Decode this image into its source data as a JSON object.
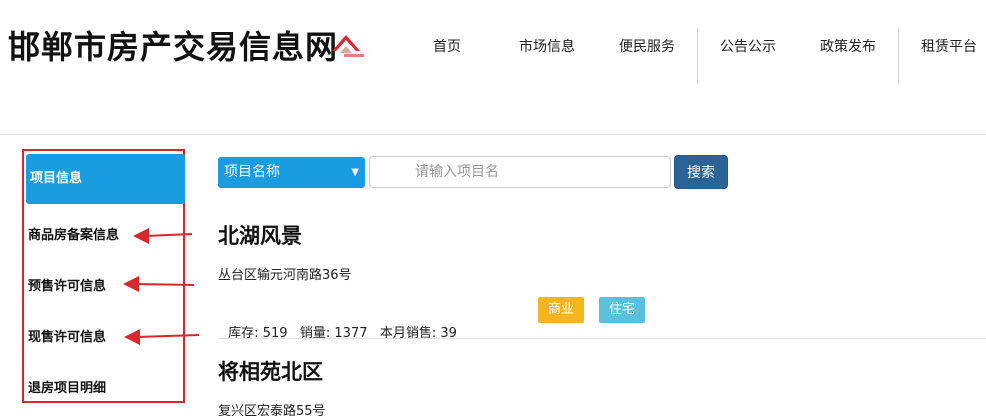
{
  "site": {
    "title": "邯郸市房产交易信息网"
  },
  "nav": [
    "首页",
    "市场信息",
    "便民服务",
    "公告公示",
    "政策发布",
    "租赁平台"
  ],
  "sidebar": {
    "items": [
      {
        "label": "项目信息"
      },
      {
        "label": "商品房备案信息"
      },
      {
        "label": "预售许可信息"
      },
      {
        "label": "现售许可信息"
      },
      {
        "label": "退房项目明细"
      }
    ]
  },
  "search": {
    "type_selected": "项目名称",
    "placeholder": "请输入项目名",
    "button_label": "搜索"
  },
  "projects": [
    {
      "name": "北湖风景",
      "address": "丛台区输元河南路36号",
      "stats": "库存: 519   销量: 1377   本月销售: 39",
      "tags": [
        "商业",
        "住宅"
      ]
    },
    {
      "name": "将相苑北区",
      "address": "复兴区宏泰路55号"
    }
  ],
  "colors": {
    "accent": "#1a9de0",
    "annotation": "#d9272e",
    "tag_commercial": "#f5b51c",
    "tag_residential": "#5bc0de"
  },
  "icons": {
    "logo": "house-roof-logo-icon",
    "annotation_arrow": "red-arrow-icon"
  }
}
